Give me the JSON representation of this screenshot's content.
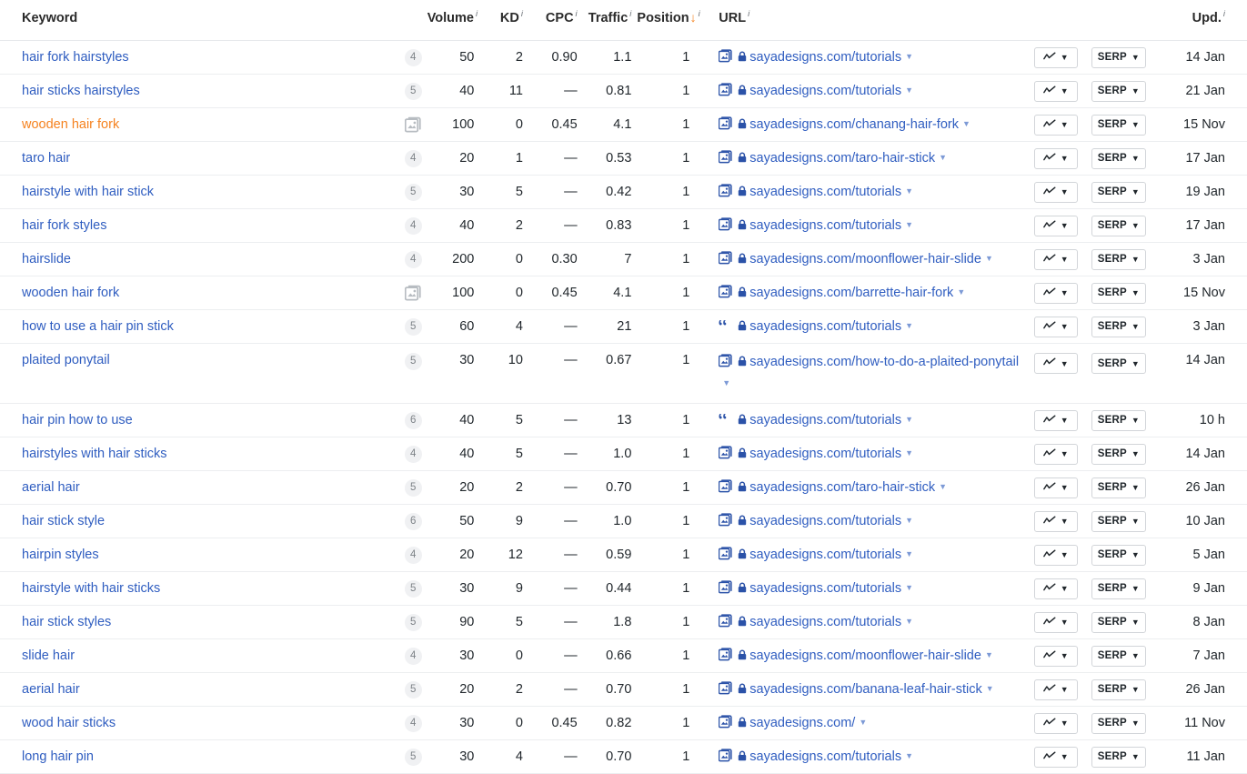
{
  "table": {
    "columns": [
      {
        "key": "keyword",
        "label": "Keyword",
        "info": true,
        "align": "left"
      },
      {
        "key": "badge",
        "label": "",
        "info": false,
        "align": "right"
      },
      {
        "key": "volume",
        "label": "Volume",
        "info": true,
        "align": "right"
      },
      {
        "key": "kd",
        "label": "KD",
        "info": true,
        "align": "right"
      },
      {
        "key": "cpc",
        "label": "CPC",
        "info": true,
        "align": "right"
      },
      {
        "key": "traffic",
        "label": "Traffic",
        "info": true,
        "align": "right"
      },
      {
        "key": "position",
        "label": "Position",
        "info": true,
        "align": "right",
        "sorted": "desc"
      },
      {
        "key": "url",
        "label": "URL",
        "info": true,
        "align": "left"
      },
      {
        "key": "chart",
        "label": "",
        "info": false,
        "align": "center"
      },
      {
        "key": "serp",
        "label": "",
        "info": false,
        "align": "center"
      },
      {
        "key": "upd",
        "label": "Upd.",
        "info": true,
        "align": "right"
      }
    ],
    "column_labels": {
      "keyword": "Keyword",
      "volume": "Volume",
      "kd": "KD",
      "cpc": "CPC",
      "traffic": "Traffic",
      "position": "Position",
      "url": "URL",
      "upd": "Upd."
    },
    "buttons": {
      "chart_label": "",
      "serp_label": "SERP"
    },
    "rows": [
      {
        "keyword": "hair fork hairstyles",
        "highlight": false,
        "badge": "4",
        "badge_type": "count",
        "volume": "50",
        "kd": "2",
        "cpc": "0.90",
        "traffic": "1.1",
        "position": "1",
        "serp_icon": "image-stack-icon",
        "url": "sayadesigns.com/tutorials",
        "upd": "14 Jan",
        "wrap": false
      },
      {
        "keyword": "hair sticks hairstyles",
        "highlight": false,
        "badge": "5",
        "badge_type": "count",
        "volume": "40",
        "kd": "11",
        "cpc": "—",
        "traffic": "0.81",
        "position": "1",
        "serp_icon": "image-stack-icon",
        "url": "sayadesigns.com/tutorials",
        "upd": "21 Jan",
        "wrap": false
      },
      {
        "keyword": "wooden hair fork",
        "highlight": true,
        "badge": "image",
        "badge_type": "icon",
        "volume": "100",
        "kd": "0",
        "cpc": "0.45",
        "traffic": "4.1",
        "position": "1",
        "serp_icon": "image-stack-icon",
        "url": "sayadesigns.com/chanang-hair-fork",
        "upd": "15 Nov",
        "wrap": false
      },
      {
        "keyword": "taro hair",
        "highlight": false,
        "badge": "4",
        "badge_type": "count",
        "volume": "20",
        "kd": "1",
        "cpc": "—",
        "traffic": "0.53",
        "position": "1",
        "serp_icon": "image-stack-icon",
        "url": "sayadesigns.com/taro-hair-stick",
        "upd": "17 Jan",
        "wrap": false
      },
      {
        "keyword": "hairstyle with hair stick",
        "highlight": false,
        "badge": "5",
        "badge_type": "count",
        "volume": "30",
        "kd": "5",
        "cpc": "—",
        "traffic": "0.42",
        "position": "1",
        "serp_icon": "image-stack-icon",
        "url": "sayadesigns.com/tutorials",
        "upd": "19 Jan",
        "wrap": false
      },
      {
        "keyword": "hair fork styles",
        "highlight": false,
        "badge": "4",
        "badge_type": "count",
        "volume": "40",
        "kd": "2",
        "cpc": "—",
        "traffic": "0.83",
        "position": "1",
        "serp_icon": "image-stack-icon",
        "url": "sayadesigns.com/tutorials",
        "upd": "17 Jan",
        "wrap": false
      },
      {
        "keyword": "hairslide",
        "highlight": false,
        "badge": "4",
        "badge_type": "count",
        "volume": "200",
        "kd": "0",
        "cpc": "0.30",
        "traffic": "7",
        "position": "1",
        "serp_icon": "image-stack-icon",
        "url": "sayadesigns.com/moonflower-hair-slide",
        "upd": "3 Jan",
        "wrap": false
      },
      {
        "keyword": "wooden hair fork",
        "highlight": false,
        "badge": "image",
        "badge_type": "icon",
        "volume": "100",
        "kd": "0",
        "cpc": "0.45",
        "traffic": "4.1",
        "position": "1",
        "serp_icon": "image-stack-icon",
        "url": "sayadesigns.com/barrette-hair-fork",
        "upd": "15 Nov",
        "wrap": false
      },
      {
        "keyword": "how to use a hair pin stick",
        "highlight": false,
        "badge": "5",
        "badge_type": "count",
        "volume": "60",
        "kd": "4",
        "cpc": "—",
        "traffic": "21",
        "position": "1",
        "serp_icon": "quote-icon",
        "url": "sayadesigns.com/tutorials",
        "upd": "3 Jan",
        "wrap": false
      },
      {
        "keyword": "plaited ponytail",
        "highlight": false,
        "badge": "5",
        "badge_type": "count",
        "volume": "30",
        "kd": "10",
        "cpc": "—",
        "traffic": "0.67",
        "position": "1",
        "serp_icon": "image-stack-icon",
        "url": "sayadesigns.com/how-to-do-a-plaited-ponytail",
        "upd": "14 Jan",
        "wrap": true
      },
      {
        "keyword": "hair pin how to use",
        "highlight": false,
        "badge": "6",
        "badge_type": "count",
        "volume": "40",
        "kd": "5",
        "cpc": "—",
        "traffic": "13",
        "position": "1",
        "serp_icon": "quote-icon",
        "url": "sayadesigns.com/tutorials",
        "upd": "10 h",
        "wrap": false
      },
      {
        "keyword": "hairstyles with hair sticks",
        "highlight": false,
        "badge": "4",
        "badge_type": "count",
        "volume": "40",
        "kd": "5",
        "cpc": "—",
        "traffic": "1.0",
        "position": "1",
        "serp_icon": "image-stack-icon",
        "url": "sayadesigns.com/tutorials",
        "upd": "14 Jan",
        "wrap": false
      },
      {
        "keyword": "aerial hair",
        "highlight": false,
        "badge": "5",
        "badge_type": "count",
        "volume": "20",
        "kd": "2",
        "cpc": "—",
        "traffic": "0.70",
        "position": "1",
        "serp_icon": "image-stack-icon",
        "url": "sayadesigns.com/taro-hair-stick",
        "upd": "26 Jan",
        "wrap": false
      },
      {
        "keyword": "hair stick style",
        "highlight": false,
        "badge": "6",
        "badge_type": "count",
        "volume": "50",
        "kd": "9",
        "cpc": "—",
        "traffic": "1.0",
        "position": "1",
        "serp_icon": "image-stack-icon",
        "url": "sayadesigns.com/tutorials",
        "upd": "10 Jan",
        "wrap": false
      },
      {
        "keyword": "hairpin styles",
        "highlight": false,
        "badge": "4",
        "badge_type": "count",
        "volume": "20",
        "kd": "12",
        "cpc": "—",
        "traffic": "0.59",
        "position": "1",
        "serp_icon": "image-stack-icon",
        "url": "sayadesigns.com/tutorials",
        "upd": "5 Jan",
        "wrap": false
      },
      {
        "keyword": "hairstyle with hair sticks",
        "highlight": false,
        "badge": "5",
        "badge_type": "count",
        "volume": "30",
        "kd": "9",
        "cpc": "—",
        "traffic": "0.44",
        "position": "1",
        "serp_icon": "image-stack-icon",
        "url": "sayadesigns.com/tutorials",
        "upd": "9 Jan",
        "wrap": false
      },
      {
        "keyword": "hair stick styles",
        "highlight": false,
        "badge": "5",
        "badge_type": "count",
        "volume": "90",
        "kd": "5",
        "cpc": "—",
        "traffic": "1.8",
        "position": "1",
        "serp_icon": "image-stack-icon",
        "url": "sayadesigns.com/tutorials",
        "upd": "8 Jan",
        "wrap": false
      },
      {
        "keyword": "slide hair",
        "highlight": false,
        "badge": "4",
        "badge_type": "count",
        "volume": "30",
        "kd": "0",
        "cpc": "—",
        "traffic": "0.66",
        "position": "1",
        "serp_icon": "image-stack-icon",
        "url": "sayadesigns.com/moonflower-hair-slide",
        "upd": "7 Jan",
        "wrap": false
      },
      {
        "keyword": "aerial hair",
        "highlight": false,
        "badge": "5",
        "badge_type": "count",
        "volume": "20",
        "kd": "2",
        "cpc": "—",
        "traffic": "0.70",
        "position": "1",
        "serp_icon": "image-stack-icon",
        "url": "sayadesigns.com/banana-leaf-hair-stick",
        "upd": "26 Jan",
        "wrap": false
      },
      {
        "keyword": "wood hair sticks",
        "highlight": false,
        "badge": "4",
        "badge_type": "count",
        "volume": "30",
        "kd": "0",
        "cpc": "0.45",
        "traffic": "0.82",
        "position": "1",
        "serp_icon": "image-stack-icon",
        "url": "sayadesigns.com/",
        "upd": "11 Nov",
        "wrap": false
      },
      {
        "keyword": "long hair pin",
        "highlight": false,
        "badge": "5",
        "badge_type": "count",
        "volume": "30",
        "kd": "4",
        "cpc": "—",
        "traffic": "0.70",
        "position": "1",
        "serp_icon": "image-stack-icon",
        "url": "sayadesigns.com/tutorials",
        "upd": "11 Jan",
        "wrap": false
      }
    ]
  },
  "colors": {
    "link": "#2f5dc0",
    "highlight": "#f5821f",
    "border": "#eceef0",
    "badge_bg": "#f0f1f3",
    "text": "#21272c"
  }
}
